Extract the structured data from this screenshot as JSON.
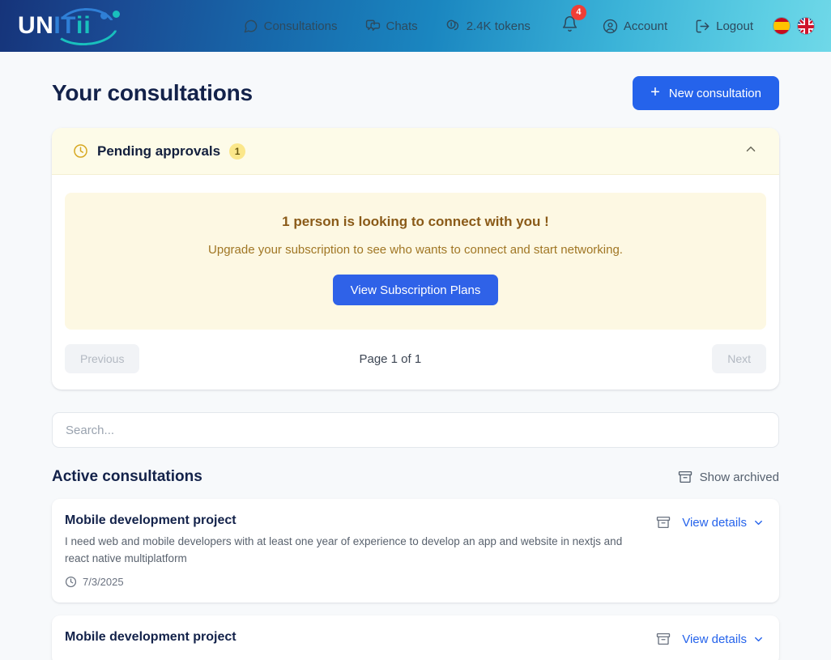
{
  "brand": {
    "logo_part1": "UN",
    "logo_part2": "IT",
    "logo_part3": "ii",
    "colors": {
      "header_gradient_start": "#16347a",
      "header_gradient_end": "#6fd8e8",
      "primary_blue": "#2563eb",
      "accent_teal": "#19c0bd",
      "badge_red": "#ef3e36",
      "pending_yellow": "#fbe78a",
      "page_bg": "#f7f9fb"
    }
  },
  "header": {
    "nav": [
      {
        "label": "Consultations",
        "icon": "chat-bubble-icon"
      },
      {
        "label": "Chats",
        "icon": "chats-icon"
      },
      {
        "label": "2.4K tokens",
        "icon": "tokens-icon"
      }
    ],
    "notifications": {
      "icon": "bell-icon",
      "count": "4"
    },
    "account": {
      "label": "Account",
      "icon": "account-circle-icon"
    },
    "logout": {
      "label": "Logout",
      "icon": "logout-icon"
    },
    "languages": [
      {
        "code": "es",
        "name": "spanish-flag"
      },
      {
        "code": "gb",
        "name": "uk-flag"
      }
    ]
  },
  "page": {
    "title": "Your consultations",
    "new_consultation_button": "New consultation",
    "new_consultation_icon": "plus-icon"
  },
  "pending": {
    "title": "Pending approvals",
    "count": "1",
    "clock_icon": "clock-icon",
    "collapse_icon": "chevron-up-icon",
    "upgrade": {
      "headline": "1 person is looking to connect with you !",
      "subtext": "Upgrade your subscription to see who wants to connect and start networking.",
      "button": "View Subscription Plans"
    },
    "pagination": {
      "previous": "Previous",
      "page_label": "Page 1 of 1",
      "next": "Next"
    }
  },
  "search": {
    "placeholder": "Search...",
    "value": ""
  },
  "list": {
    "title": "Active consultations",
    "show_archived": "Show archived",
    "archive_icon": "archive-icon",
    "view_details_label": "View details",
    "chevron_icon": "chevron-down-icon",
    "clock_icon": "clock-icon",
    "items": [
      {
        "title": "Mobile development project",
        "description": "I need web and mobile developers with at least one year of experience to develop an app and website in nextjs and react native multiplatform",
        "date": "7/3/2025"
      },
      {
        "title": "Mobile development project",
        "description": "",
        "date": ""
      }
    ]
  }
}
